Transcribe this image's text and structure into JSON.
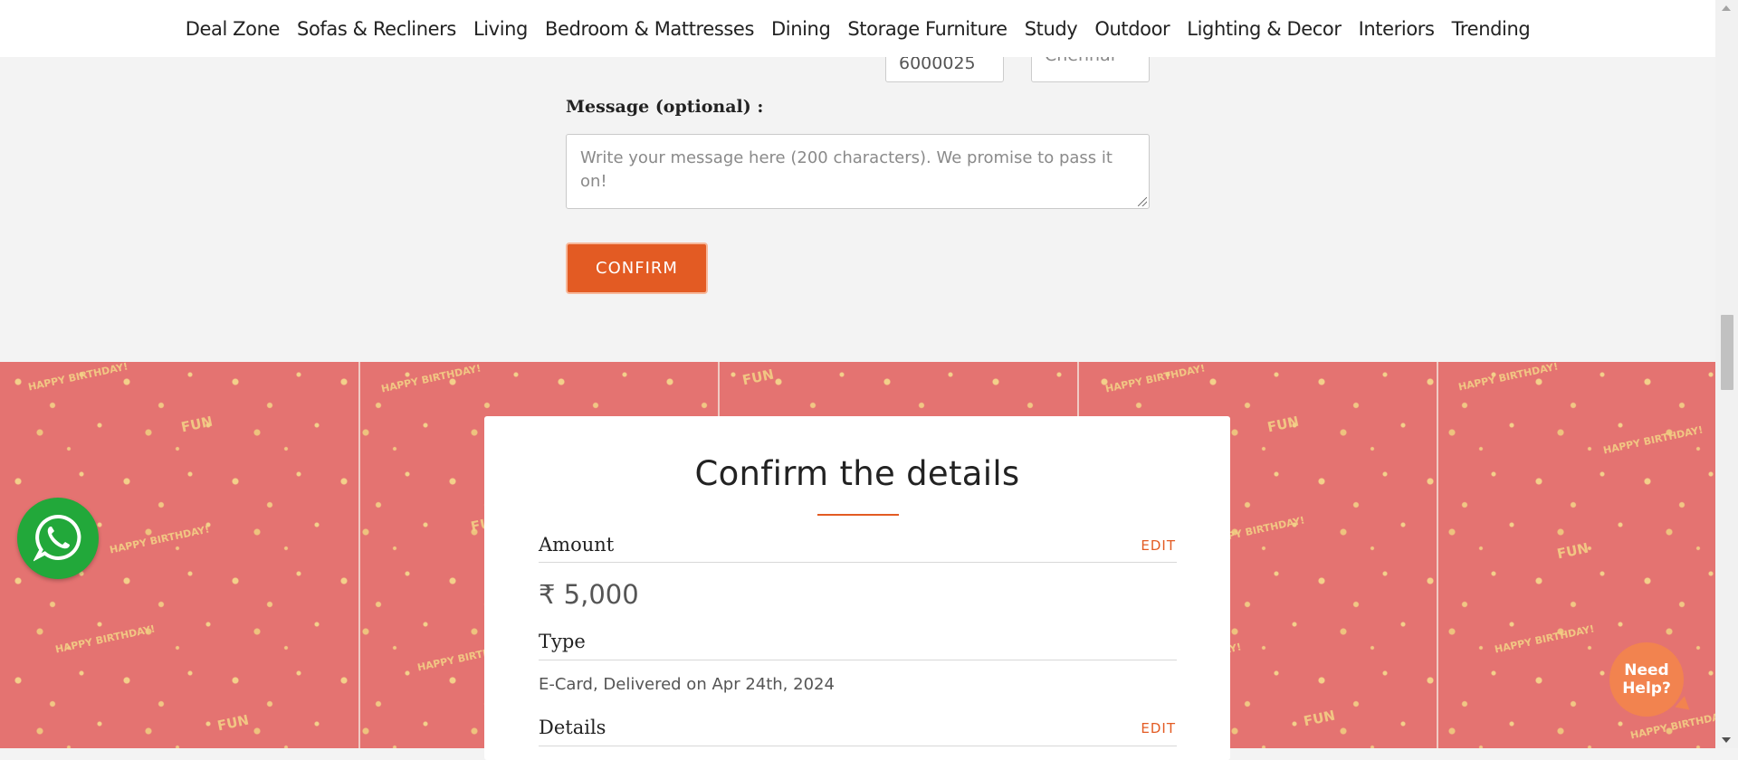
{
  "nav": {
    "items": [
      {
        "label": "Deal Zone"
      },
      {
        "label": "Sofas & Recliners"
      },
      {
        "label": "Living"
      },
      {
        "label": "Bedroom & Mattresses"
      },
      {
        "label": "Dining"
      },
      {
        "label": "Storage Furniture"
      },
      {
        "label": "Study"
      },
      {
        "label": "Outdoor"
      },
      {
        "label": "Lighting & Decor"
      },
      {
        "label": "Interiors"
      },
      {
        "label": "Trending"
      }
    ]
  },
  "form": {
    "pincode_value": "6000025",
    "city_value": "Chennai",
    "message_label": "Message (optional) :",
    "message_placeholder": "Write your message here (200 characters). We promise to pass it on!",
    "confirm_label": "CONFIRM"
  },
  "pattern": {
    "doodle_text": [
      "HAPPY BIRTHDAY!",
      "FUN"
    ]
  },
  "summary": {
    "title": "Confirm the details",
    "amount_label": "Amount",
    "amount_edit": "EDIT",
    "amount_value": "₹ 5,000",
    "type_label": "Type",
    "type_value": "E-Card, Delivered on Apr 24th, 2024",
    "details_label": "Details",
    "details_edit": "EDIT"
  },
  "floating": {
    "whatsapp_icon": "whatsapp-icon",
    "help_label": "Need Help?"
  },
  "colors": {
    "accent": "#e35b23",
    "pattern_bg": "#e47371",
    "whatsapp": "#22a83a",
    "help_bubble": "#f2834f"
  }
}
